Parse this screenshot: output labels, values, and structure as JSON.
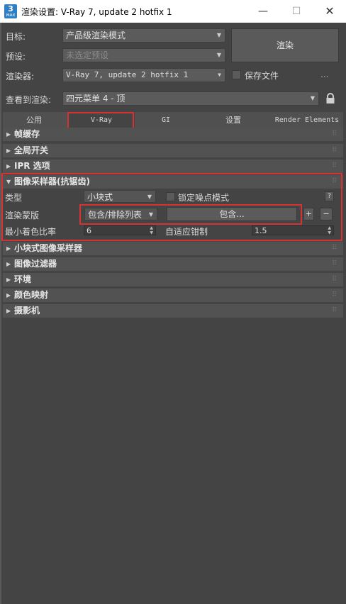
{
  "window": {
    "app_icon_number": "3",
    "app_icon_sub": "MAX",
    "title": "渲染设置: V-Ray 7, update 2 hotfix 1",
    "minimize_glyph": "—",
    "maximize_glyph": "☐",
    "close_glyph": "✕"
  },
  "form": {
    "target_label": "目标:",
    "target_value": "产品级渲染模式",
    "preset_label": "预设:",
    "preset_value": "未选定预设",
    "renderer_label": "渲染器:",
    "renderer_value": "V-Ray 7, update 2 hotfix 1",
    "save_file_label": "保存文件",
    "more_button": "...",
    "view_label": "查看到渲染:",
    "view_value": "四元菜单 4 - 顶",
    "render_button": "渲染"
  },
  "tabs": [
    {
      "label": "公用"
    },
    {
      "label": "V-Ray"
    },
    {
      "label": "GI"
    },
    {
      "label": "设置"
    },
    {
      "label": "Render Elements"
    }
  ],
  "rollouts": {
    "frame_buffer": "帧缓存",
    "global_switches": "全局开关",
    "ipr_options": "IPR 选项",
    "image_sampler": "图像采样器(抗锯齿)",
    "bucket_sampler": "小块式图像采样器",
    "image_filter": "图像过滤器",
    "environment": "环境",
    "color_mapping": "颜色映射",
    "camera": "摄影机"
  },
  "image_sampler": {
    "type_label": "类型",
    "type_value": "小块式",
    "lock_noise_label": "锁定噪点模式",
    "help_button": "?",
    "render_mask_label": "渲染蒙版",
    "mask_mode_value": "包含/排除列表",
    "include_button": "包含...",
    "plus_button": "+",
    "minus_button": "−",
    "min_shading_rate_label": "最小着色比率",
    "min_shading_rate_value": "6",
    "adaptive_clamp_label": "自适应钳制",
    "adaptive_clamp_value": "1.5"
  },
  "colors": {
    "background": "#444444",
    "highlight_box": "#d63232",
    "title_bar": "#ffffff"
  }
}
